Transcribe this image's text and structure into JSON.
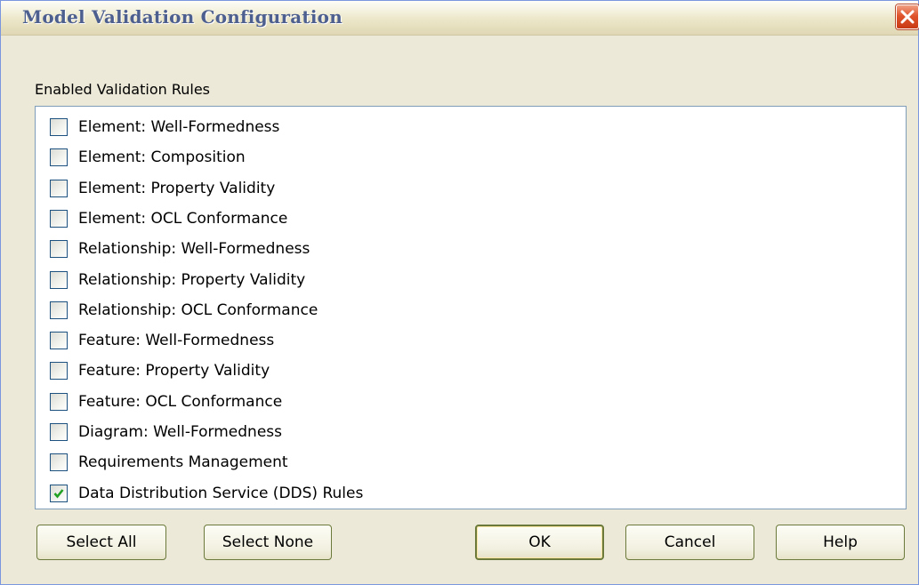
{
  "window": {
    "title": "Model Validation Configuration"
  },
  "group_label": "Enabled Validation Rules",
  "rules": [
    {
      "label": "Element: Well-Formedness",
      "checked": false
    },
    {
      "label": "Element: Composition",
      "checked": false
    },
    {
      "label": "Element: Property Validity",
      "checked": false
    },
    {
      "label": "Element: OCL Conformance",
      "checked": false
    },
    {
      "label": "Relationship: Well-Formedness",
      "checked": false
    },
    {
      "label": "Relationship: Property Validity",
      "checked": false
    },
    {
      "label": "Relationship: OCL Conformance",
      "checked": false
    },
    {
      "label": "Feature: Well-Formedness",
      "checked": false
    },
    {
      "label": "Feature: Property Validity",
      "checked": false
    },
    {
      "label": "Feature: OCL Conformance",
      "checked": false
    },
    {
      "label": "Diagram: Well-Formedness",
      "checked": false
    },
    {
      "label": "Requirements Management",
      "checked": false
    },
    {
      "label": "Data Distribution Service (DDS) Rules",
      "checked": true
    }
  ],
  "buttons": {
    "select_all": "Select All",
    "select_none": "Select None",
    "ok": "OK",
    "cancel": "Cancel",
    "help": "Help"
  },
  "icons": {
    "close": "close-icon",
    "check": "checkmark-icon"
  },
  "colors": {
    "title_text": "#4d5f8e",
    "close_button": "#e0542c",
    "checkmark": "#21a121",
    "dialog_bg": "#ece9d8"
  }
}
